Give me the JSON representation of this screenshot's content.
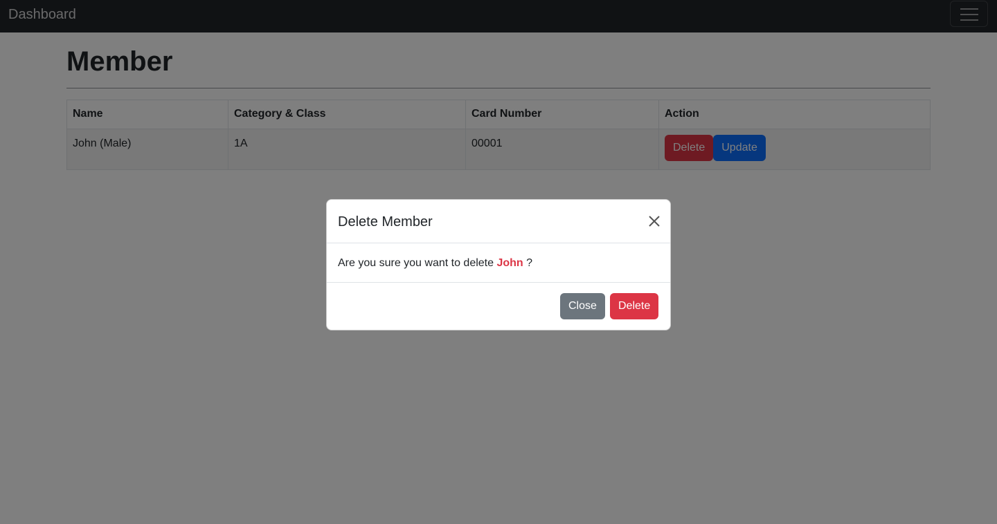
{
  "navbar": {
    "brand": "Dashboard",
    "toggler_icon": "hamburger-icon"
  },
  "page": {
    "title": "Member"
  },
  "table": {
    "headers": [
      "Name",
      "Category & Class",
      "Card Number",
      "Action"
    ],
    "rows": [
      {
        "name": "John (Male)",
        "category_class": "1A",
        "card_number": "00001",
        "delete_label": "Delete",
        "update_label": "Update"
      }
    ]
  },
  "modal": {
    "title": "Delete Member",
    "close_icon": "close-icon",
    "message_prefix": "Are you sure you want to delete",
    "member_name": "John",
    "message_suffix": " ?",
    "close_label": "Close",
    "delete_label": "Delete"
  },
  "colors": {
    "danger": "#dc3545",
    "primary": "#0d6efd",
    "secondary": "#6c757d",
    "navbar": "#212529"
  }
}
